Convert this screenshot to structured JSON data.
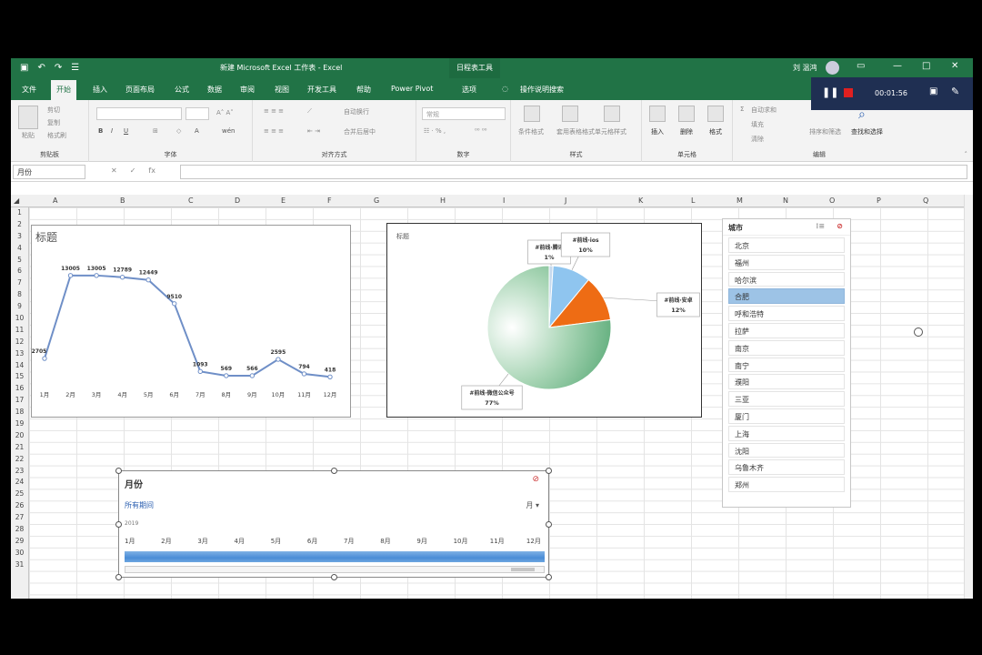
{
  "titlebar": {
    "doc_title": "新建 Microsoft Excel 工作表 - Excel",
    "context_tab": "日程表工具",
    "user": "刘 温鸿",
    "window_buttons": [
      "▭",
      "—",
      "□",
      "✕"
    ]
  },
  "tabs": [
    "文件",
    "开始",
    "插入",
    "页面布局",
    "公式",
    "数据",
    "审阅",
    "视图",
    "开发工具",
    "帮助",
    "Power Pivot",
    "选项",
    "操作说明搜索"
  ],
  "active_tab": "开始",
  "ribbon": {
    "groups": [
      "剪贴板",
      "字体",
      "对齐方式",
      "数字",
      "样式",
      "单元格",
      "编辑"
    ],
    "clipboard": [
      "粘贴",
      "剪切",
      "复制",
      "格式刷"
    ],
    "font_buttons": [
      "B",
      "I",
      "U"
    ],
    "align_buttons": [
      "自动换行",
      "合并后居中"
    ],
    "number_format": "常规",
    "styles": [
      "条件格式",
      "套用表格格式",
      "单元格样式"
    ],
    "cells": [
      "插入",
      "删除",
      "格式"
    ],
    "editing": [
      "自动求和",
      "填充",
      "清除",
      "排序和筛选",
      "查找和选择"
    ]
  },
  "recorder": {
    "time": "00:01:56"
  },
  "formula_bar": {
    "name_box": "月份",
    "fx": "fx"
  },
  "columns": [
    "A",
    "B",
    "C",
    "D",
    "E",
    "F",
    "G",
    "H",
    "I",
    "J",
    "K",
    "L",
    "M",
    "N",
    "O",
    "P",
    "Q"
  ],
  "rows": [
    "1",
    "2",
    "3",
    "4",
    "5",
    "6",
    "7",
    "8",
    "9",
    "10",
    "11",
    "12",
    "13",
    "14",
    "15",
    "16",
    "17",
    "18",
    "19",
    "20",
    "21",
    "22",
    "23",
    "24",
    "25",
    "26",
    "27",
    "28",
    "29",
    "30",
    "31"
  ],
  "chart_data": [
    {
      "type": "line",
      "title": "标题",
      "categories": [
        "1月",
        "2月",
        "3月",
        "4月",
        "5月",
        "6月",
        "7月",
        "8月",
        "9月",
        "10月",
        "11月",
        "12月"
      ],
      "values": [
        2705,
        13005,
        13005,
        12789,
        12449,
        9510,
        1093,
        569,
        566,
        2595,
        794,
        418
      ],
      "ylim": [
        0,
        14000
      ],
      "color": "#6f8fc7"
    },
    {
      "type": "pie",
      "title": "标题",
      "slices": [
        {
          "label": "#前线·腾讯",
          "value": 1,
          "pct": "1%",
          "color": "#c5d9ee"
        },
        {
          "label": "#前线·ios",
          "value": 10,
          "pct": "10%",
          "color": "#8fc5ef"
        },
        {
          "label": "#前线·安卓",
          "value": 12,
          "pct": "12%",
          "color": "#ee6c14"
        },
        {
          "label": "#前线·微信公众号",
          "value": 77,
          "pct": "77%",
          "color": "#6db58a"
        }
      ]
    }
  ],
  "city_slicer": {
    "title": "城市",
    "items": [
      "北京",
      "福州",
      "哈尔滨",
      "合肥",
      "呼和浩特",
      "拉萨",
      "南京",
      "南宁",
      "濮阳",
      "三亚",
      "厦门",
      "上海",
      "沈阳",
      "乌鲁木齐",
      "郑州"
    ],
    "selected": "合肥"
  },
  "timeline": {
    "title": "月份",
    "period_label": "所有期间",
    "level": "月",
    "year": "2019",
    "months": [
      "1月",
      "2月",
      "3月",
      "4月",
      "5月",
      "6月",
      "7月",
      "8月",
      "9月",
      "10月",
      "11月",
      "12月"
    ]
  }
}
